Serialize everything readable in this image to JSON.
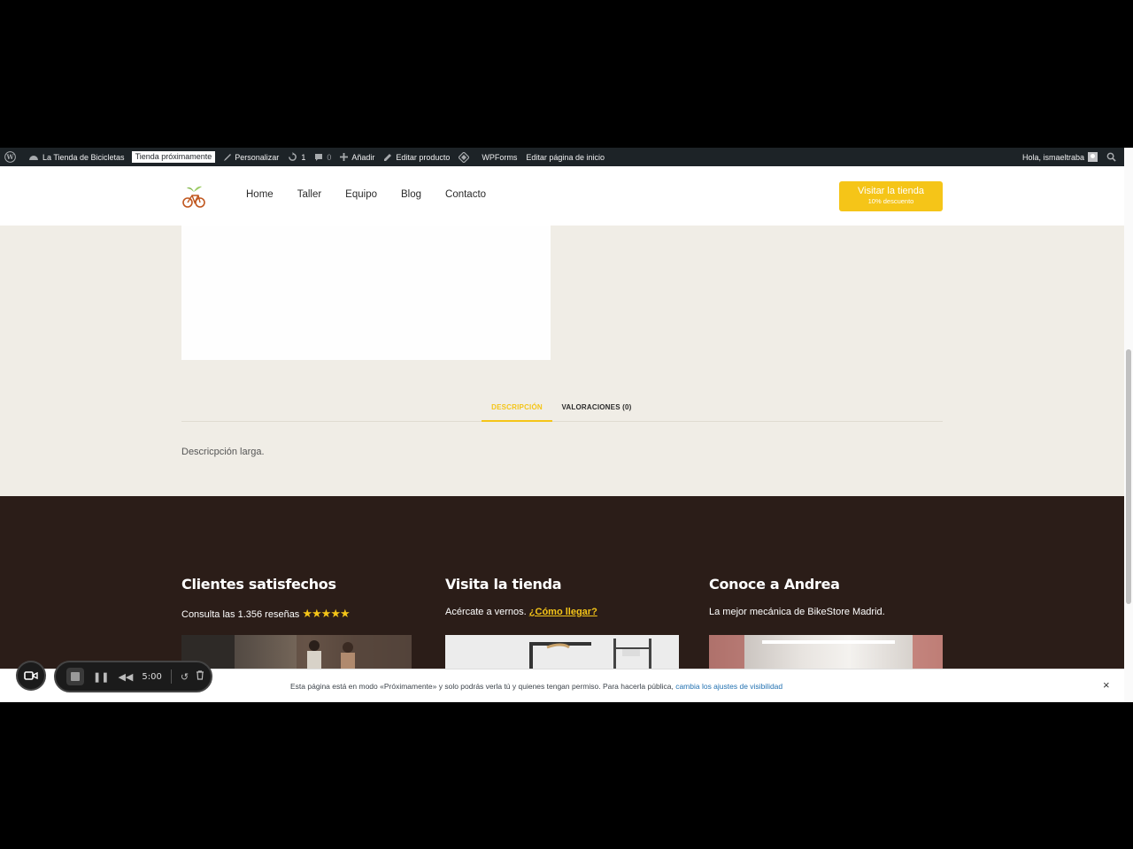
{
  "admin_bar": {
    "site_name": "La Tienda de Bicicletas",
    "coming_soon": "Tienda próximamente",
    "customize": "Personalizar",
    "updates_count": "1",
    "comments_count": "0",
    "add_new": "Añadir",
    "edit_product": "Editar producto",
    "wpforms": "WPForms",
    "edit_home": "Editar página de inicio",
    "greeting": "Hola, ismaeltraba"
  },
  "header": {
    "nav": [
      "Home",
      "Taller",
      "Equipo",
      "Blog",
      "Contacto"
    ],
    "cta_label": "Visitar la tienda",
    "cta_sub": "10% descuento",
    "accent": "#f5c518"
  },
  "product": {
    "tabs": [
      "DESCRIPCIÓN",
      "VALORACIONES (0)"
    ],
    "active_tab": "DESCRIPCIÓN",
    "description": "Descricpción larga."
  },
  "footer": {
    "bg": "#2b1d18",
    "columns": [
      {
        "title": "Clientes satisfechos",
        "text": "Consulta las 1.356 reseñas",
        "stars": "★★★★★"
      },
      {
        "title": "Visita la tienda",
        "text": "Acércate a vernos.",
        "link": "¿Cómo llegar?"
      },
      {
        "title": "Conoce a Andrea",
        "text": "La mejor mecánica de BikeStore Madrid."
      }
    ]
  },
  "notice": {
    "text": "Esta página está en modo «Próximamente» y solo podrás verla tú y quienes tengan permiso. Para hacerla pública,",
    "link": "cambia los ajustes de visibilidad",
    "close": "×"
  },
  "recorder": {
    "time": "5:00"
  }
}
